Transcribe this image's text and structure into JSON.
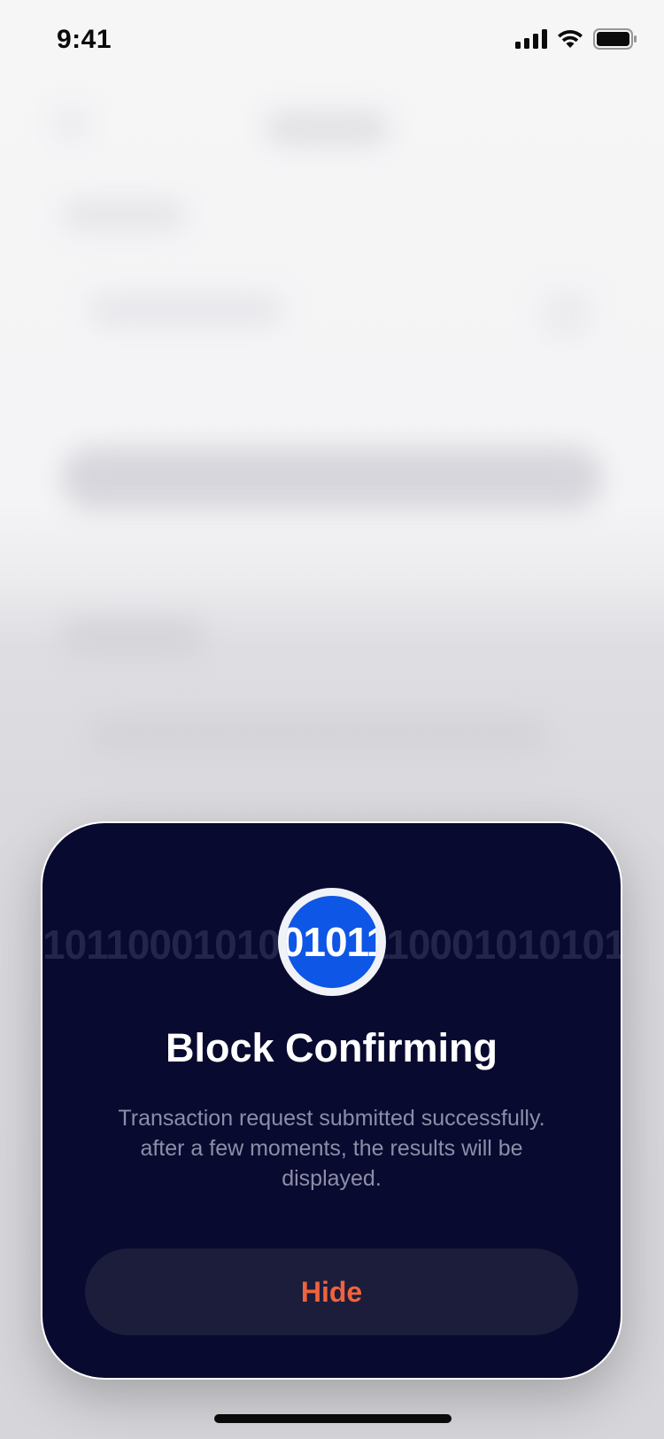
{
  "status_bar": {
    "time": "9:41",
    "icons": [
      "cellular-signal-icon",
      "wifi-icon",
      "battery-icon"
    ]
  },
  "modal": {
    "binary_text": "1011000101010101100010101010",
    "icon_text": "01011",
    "icon_name": "binary-block-icon",
    "title": "Block Confirming",
    "message": "Transaction request submitted successfully. after a few moments, the results will be displayed.",
    "hide_label": "Hide"
  },
  "colors": {
    "modal_background": "#090a30",
    "icon_blue": "#0e56e5",
    "hide_text": "#f0633d",
    "hide_button_background": "#1b1d3b",
    "message_text": "#8d8ea6"
  }
}
